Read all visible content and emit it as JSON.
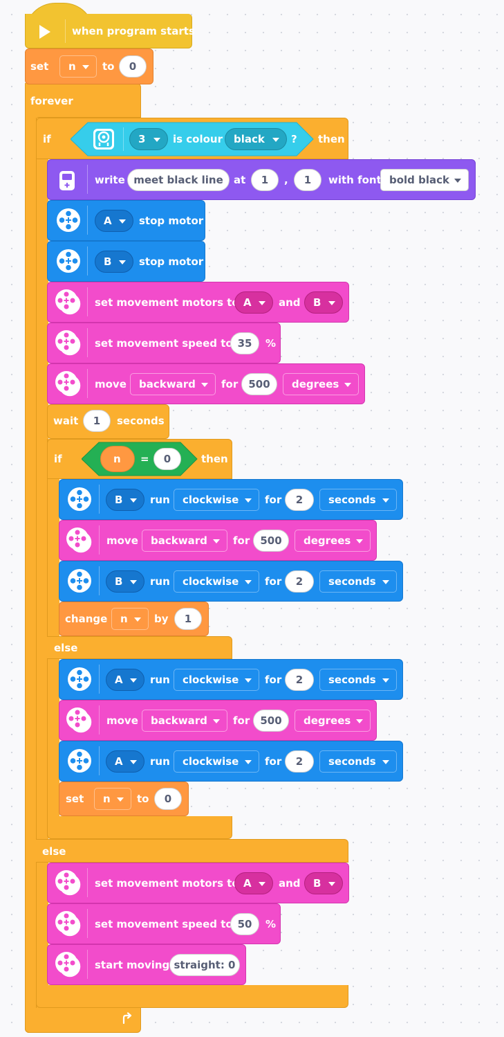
{
  "hat": {
    "label": "when program starts"
  },
  "set_var": {
    "set": "set",
    "var": "n",
    "to": "to",
    "value": "0"
  },
  "forever": {
    "label": "forever"
  },
  "if_colour": {
    "if": "if",
    "port": "3",
    "is_colour": "is colour",
    "colour": "black",
    "q": "?",
    "then": "then"
  },
  "write": {
    "write": "write",
    "text": "meet black line",
    "at": "at",
    "x": "1",
    "comma": ",",
    "y": "1",
    "with_font": "with font",
    "font": "bold black"
  },
  "stopA": {
    "port": "A",
    "label": "stop motor"
  },
  "stopB": {
    "port": "B",
    "label": "stop motor"
  },
  "mm1": {
    "label": "set movement motors to",
    "a": "A",
    "and": "and",
    "b": "B"
  },
  "ms1": {
    "label": "set movement speed to",
    "value": "35",
    "unit": "%"
  },
  "move1": {
    "move": "move",
    "dir": "backward",
    "for": "for",
    "value": "500",
    "unit": "degrees"
  },
  "wait": {
    "wait": "wait",
    "value": "1",
    "unit": "seconds"
  },
  "if_n": {
    "if": "if",
    "var": "n",
    "eq": "=",
    "value": "0",
    "then": "then"
  },
  "run1": {
    "port": "B",
    "run": "run",
    "dir": "clockwise",
    "for": "for",
    "value": "2",
    "unit": "seconds"
  },
  "move2": {
    "move": "move",
    "dir": "backward",
    "for": "for",
    "value": "500",
    "unit": "degrees"
  },
  "run2": {
    "port": "B",
    "run": "run",
    "dir": "clockwise",
    "for": "for",
    "value": "2",
    "unit": "seconds"
  },
  "change": {
    "change": "change",
    "var": "n",
    "by": "by",
    "value": "1"
  },
  "else_inner": {
    "label": "else"
  },
  "run3": {
    "port": "A",
    "run": "run",
    "dir": "clockwise",
    "for": "for",
    "value": "2",
    "unit": "seconds"
  },
  "move3": {
    "move": "move",
    "dir": "backward",
    "for": "for",
    "value": "500",
    "unit": "degrees"
  },
  "run4": {
    "port": "A",
    "run": "run",
    "dir": "clockwise",
    "for": "for",
    "value": "2",
    "unit": "seconds"
  },
  "set2": {
    "set": "set",
    "var": "n",
    "to": "to",
    "value": "0"
  },
  "else_outer": {
    "label": "else"
  },
  "mm2": {
    "label": "set movement motors to",
    "a": "A",
    "and": "and",
    "b": "B"
  },
  "ms2": {
    "label": "set movement speed to",
    "value": "50",
    "unit": "%"
  },
  "start": {
    "label": "start moving",
    "value": "straight: 0"
  },
  "icons": {
    "play": "play-icon",
    "sensor": "color-sensor-icon",
    "hub": "hub-display-icon",
    "motor": "motor-icon",
    "movement": "movement-icon",
    "loop": "loop-arrow-icon"
  },
  "colors": {
    "control": "#FBAF2F",
    "events": "#F2C330",
    "variables": "#FF9841",
    "display": "#8E59F0",
    "motor": "#1D8EEE",
    "movement": "#F24CCB",
    "sensor": "#36CDEB",
    "operator": "#24B054"
  }
}
